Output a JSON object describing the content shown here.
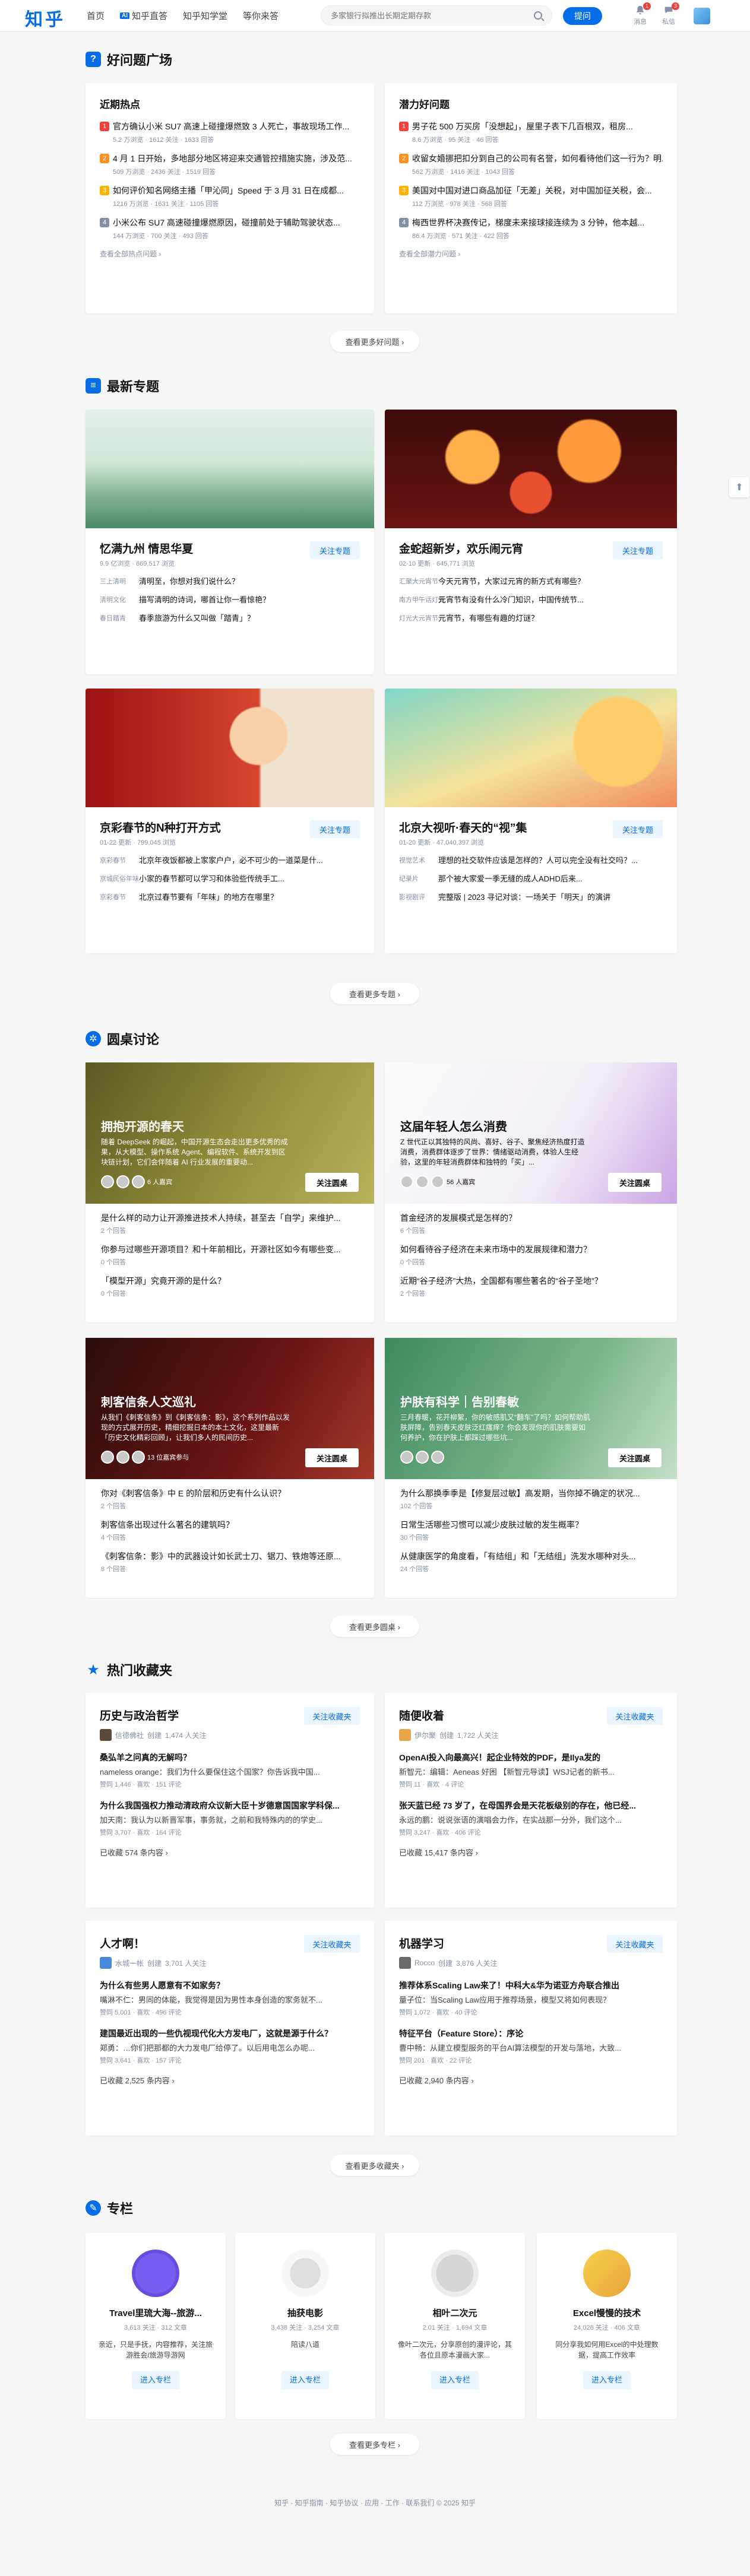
{
  "header": {
    "logo": "知乎",
    "nav": [
      "首页",
      "知乎直答",
      "知乎知学堂",
      "等你来答"
    ],
    "zhida_badge": "AI",
    "search_placeholder": "多家银行拟推出长期定期存款",
    "ask_label": "提问",
    "messages_label": "消息",
    "messages_count": "1",
    "chat_label": "私信",
    "chat_count": "3"
  },
  "sections": {
    "questions": "好问题广场",
    "topics": "最新专题",
    "roundtable": "圆桌讨论",
    "collections": "热门收藏夹",
    "columns": "专栏"
  },
  "questions": {
    "left": {
      "title": "近期热点",
      "items": [
        {
          "n": "1",
          "q": "官方确认小米 SU7 高速上碰撞爆燃致 3 人死亡，事故现场工作...",
          "m": "5.2 万浏览 · 1612 关注 · 1633 回答"
        },
        {
          "n": "2",
          "q": "4 月 1 日开始，多地部分地区将迎来交通管控措施实施，涉及范...",
          "m": "509 万浏览 · 2436 关注 · 1519 回答"
        },
        {
          "n": "3",
          "q": "如何评价知名网络主播「甲沁同」Speed 于 3 月 31 日在成都...",
          "m": "1216 万浏览 · 1631 关注 · 1105 回答"
        },
        {
          "n": "4",
          "q": "小米公布 SU7 高速碰撞爆燃原因，碰撞前处于辅助驾驶状态...",
          "m": "144 万浏览 · 700 关注 · 493 回答"
        }
      ],
      "more": "查看全部热点问题 ›"
    },
    "right": {
      "title": "潜力好问题",
      "items": [
        {
          "n": "1",
          "q": "男子花 500 万买房「没想起」，屋里子表下几百根双，租房...",
          "m": "8.6 万浏览 · 95 关注 · 46 回答"
        },
        {
          "n": "2",
          "q": "收留女婚挪把扣分到自己的公司有名誉，如何看待他们这一行为？明...",
          "m": "562 万浏览 · 1416 关注 · 1043 回答"
        },
        {
          "n": "3",
          "q": "美国对中国对进口商品加征「无差」关税，对中国加征关税，会...",
          "m": "112 万浏览 · 978 关注 · 568 回答"
        },
        {
          "n": "4",
          "q": "梅西世界杯决赛传记，梯度未来接球接连续为 3 分钟，他本越...",
          "m": "86.4 万浏览 · 571 关注 · 422 回答"
        }
      ],
      "more": "查看全部潜力问题 ›"
    },
    "more_pill": "查看更多好问题 ›"
  },
  "topics": [
    {
      "title": "忆满九州 情思华夏",
      "meta": "9.9 亿浏览 · 669,517 浏览",
      "follow": "关注专题",
      "qs": [
        {
          "t": "三上清明",
          "q": "清明至，你想对我们说什么？"
        },
        {
          "t": "清明文化",
          "q": "描写清明的诗词，哪首让你一看惊艳？"
        },
        {
          "t": "春日踏青",
          "q": "春季旅游为什么又叫做「踏青」？"
        }
      ]
    },
    {
      "title": "金蛇超新岁，欢乐闹元宵",
      "meta": "02-10 更新 · 645,771 浏览",
      "follow": "关注专题",
      "qs": [
        {
          "t": "汇聚大元宵节",
          "q": "今天元宵节，大家过元宵的新方式有哪些？"
        },
        {
          "t": "南方甲午话灯笼",
          "q": "元宵节有没有什么冷门知识，中国传统节..."
        },
        {
          "t": "灯光大元宵节",
          "q": "元宵节，有哪些有趣的灯谜？"
        }
      ]
    },
    {
      "title": "京彩春节的N种打开方式",
      "meta": "01-22 更新 · 799,045 浏览",
      "follow": "关注专题",
      "qs": [
        {
          "t": "京彩春节",
          "q": "北京年夜饭都被上家家户户，必不可少的一道菜是什..."
        },
        {
          "t": "京城民俗年味",
          "q": "小家的春节都可以学习和体验些传统手工..."
        },
        {
          "t": "京彩春节",
          "q": "北京过春节要有「年味」的地方在哪里？"
        }
      ]
    },
    {
      "title": "北京大视听·春天的“视”集",
      "meta": "01-20 更新 · 47,040,397 浏览",
      "follow": "关注专题",
      "qs": [
        {
          "t": "视觉艺术",
          "q": "理想的社交软件应该是怎样的？人可以完全没有社交吗？..."
        },
        {
          "t": "纪录片",
          "q": "那个被大家爱一季无缝的成人ADHD后来..."
        },
        {
          "t": "影视剧评",
          "q": "完整版 | 2023 寻记对谈：一场关于「明天」的演讲"
        }
      ]
    }
  ],
  "topics_more": "查看更多专题 ›",
  "roundtables": [
    {
      "title": "拥抱开源的春天",
      "desc": "随着 DeepSeek 的崛起，中国开源生态会走出更多优秀的成果，从大模型、操作系统 Agent、编程软件、系统开发到区块链计划，它们会伴随着 AI 行业发展的重要动...",
      "host": "6 人嘉宾",
      "join": "关注圆桌",
      "qs": [
        {
          "q": "是什么样的动力让开源推进技术人持续，甚至去「自学」来维护...",
          "a": "2 个回答"
        },
        {
          "q": "你参与过哪些开源项目？和十年前相比，开源社区如今有哪些变...",
          "a": "0 个回答"
        },
        {
          "q": "「模型开源」究竟开源的是什么？",
          "a": "0 个回答"
        }
      ]
    },
    {
      "title": "这届年轻人怎么消费",
      "desc": "Z 世代正以其独特的风尚、喜好、谷子、聚焦经济热度打造消费，消费群体逐步了世界：情绪驱动消费，体验人生经验，这里的年轻消费群体和独特的「买」...",
      "host": "56 人嘉宾",
      "join": "关注圆桌",
      "qs": [
        {
          "q": "首金经济的发展模式是怎样的？",
          "a": "6 个回答"
        },
        {
          "q": "如何看待谷子经济在未来市场中的发展规律和潜力？",
          "a": "0 个回答"
        },
        {
          "q": "近期“谷子经济”大热，全国都有哪些著名的“谷子圣地”？",
          "a": "2 个回答"
        }
      ]
    },
    {
      "title": "刺客信条人文巡礼",
      "desc": "从我们《刺客信条》到《刺客信条：影》，这个系列作品以发现的方式展开历史，精细挖掘日本的本土文化，这里最新「历史文化精彩回顾」，让我们多人的民间历史...",
      "host": "13 位嘉宾参与",
      "join": "关注圆桌",
      "qs": [
        {
          "q": "你对《刺客信条》中 E 的阶层和历史有什么认识？",
          "a": "2 个回答"
        },
        {
          "q": "刺客信条出现过什么著名的建筑吗？",
          "a": "4 个回答"
        },
        {
          "q": "《刺客信条：影》中的武器设计如长武士刀、锯刀、铁炮等还原...",
          "a": "8 个回答"
        }
      ]
    },
    {
      "title": "护肤有科学｜告别春敏",
      "desc": "三月春暖，花开柳絮，你的敏感肌又“翻车”了吗？如何帮助肌肤屏障，告别春天皮肤泛红瘙痒？你会发现你的肌肤需要如何养护，你在护肤上都踩过哪些坑...",
      "host": "",
      "join": "关注圆桌",
      "qs": [
        {
          "q": "为什么那换季季是【修复层过敏】高发期，当你掉不确定的状况...",
          "a": "102 个回答"
        },
        {
          "q": "日常生活哪些习惯可以减少皮肤过敏的发生概率？",
          "a": "30 个回答"
        },
        {
          "q": "从健康医学的角度看，「有结组」和「无结组」洗发水哪种对头...",
          "a": "24 个回答"
        }
      ]
    }
  ],
  "roundtables_more": "查看更多圆桌 ›",
  "collections": [
    {
      "title": "历史与政治哲学",
      "user": "信德佛社",
      "action": "创建",
      "followers": "1,474 人关注",
      "follow": "关注收藏夹",
      "items": [
        {
          "h": "桑弘羊之问真的无解吗？",
          "d": "nameless orange：我们为什么要保住这个国家？你告诉我中国...",
          "s": "赞同 1,446 · 喜欢 · 151 评论"
        },
        {
          "h": "为什么我国强权力推动清政府众议新大臣十岁德意国国家学科保...",
          "d": "加天南：我认为以新晋军事，事务就，之前和我特殊内的的学史...",
          "s": "赞同 3,707 · 喜欢 · 164 评论"
        }
      ],
      "count": "已收藏 574 条内容 ›"
    },
    {
      "title": "随便收着",
      "user": "伊尔聚",
      "action": "创建",
      "followers": "1,722 人关注",
      "follow": "关注收藏夹",
      "items": [
        {
          "h": "OpenAI投入向最高兴！起企业特效的PDF，是Ilya发的",
          "d": "新智元：编辑：Aeneas 好困 【新智元导读】WSJ记者的新书...",
          "s": "赞同 11 · 喜欢 · 4 评论"
        },
        {
          "h": "张天蓝已经 73 岁了，在母国界会是天花板级别的存在，他已经...",
          "d": "永远的鹏：说说张语的演唱会力作，在实战那一分外，我们这个...",
          "s": "赞同 3,247 · 喜欢 · 406 评论"
        }
      ],
      "count": "已收藏 15,417 条内容 ›"
    },
    {
      "title": "人才啊！",
      "user": "水城一帐",
      "action": "创建",
      "followers": "3,701 人关注",
      "follow": "关注收藏夹",
      "items": [
        {
          "h": "为什么有些男人愿意有不如家务？",
          "d": "嘴淋不仁：男同的体能，我觉得是因为男性本身创造的家务就不...",
          "s": "赞同 5,001 · 喜欢 · 496 评论"
        },
        {
          "h": "建国最近出现的一些仇视现代化大方发电厂，这就是源于什么？",
          "d": "郑勇：…你们把那都的大力发电厂给停了。以后用电怎么办呢...",
          "s": "赞同 3,641 · 喜欢 · 157 评论"
        }
      ],
      "count": "已收藏 2,525 条内容 ›"
    },
    {
      "title": "机器学习",
      "user": "Rocco",
      "action": "创建",
      "followers": "3,876 人关注",
      "follow": "关注收藏夹",
      "items": [
        {
          "h": "推荐体系Scaling Law来了！中科大&华为诺亚方舟联合推出",
          "d": "量子位：当Scaling Law应用于推荐场景，模型又将如何表现？",
          "s": "赞同 1,072 · 喜欢 · 40 评论"
        },
        {
          "h": "特征平台（Feature Store）：序论",
          "d": "曹中畅：从建立模型服务的平台AI算法模型的开发与落地，大致...",
          "s": "赞同 201 · 喜欢 · 22 评论"
        }
      ],
      "count": "已收藏 2,940 条内容 ›"
    }
  ],
  "collections_more": "查看更多收藏夹 ›",
  "columns": [
    {
      "name": "Travel里琉大海--旅游...",
      "meta": "3,613 关注 · 312 文章",
      "desc": "亲近，只是手抚，内容推荐，关注旅游胜会/旅游导游网",
      "btn": "进入专栏"
    },
    {
      "name": "抽获电影",
      "meta": "3,438 关注 · 3,254 文章",
      "desc": "陪读八道",
      "btn": "进入专栏"
    },
    {
      "name": "相叶二次元",
      "meta": "2.01 关注 · 1,694 文章",
      "desc": "像叶二次元，分享原创的漫评论，其各位且原本漫画大家...",
      "btn": "进入专栏"
    },
    {
      "name": "Excel慢慢的技术",
      "meta": "24,026 关注 · 406 文章",
      "desc": "同分享我如何用Excel的中处理数据，提高工作效率",
      "btn": "进入专栏"
    }
  ],
  "columns_more": "查看更多专栏 ›",
  "footer": "知乎 · 知乎指南 · 知乎协议 · 应用 · 工作 · 联系我们 © 2025 知乎"
}
